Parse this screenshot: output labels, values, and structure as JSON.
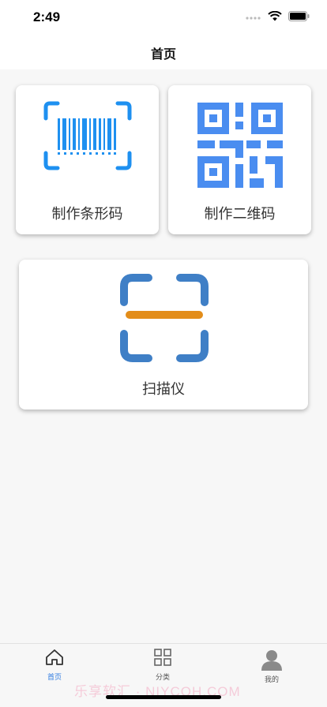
{
  "status": {
    "time": "2:49"
  },
  "nav": {
    "title": "首页"
  },
  "cards": {
    "barcode": {
      "label": "制作条形码",
      "icon": "barcode-icon"
    },
    "qrcode": {
      "label": "制作二维码",
      "icon": "qr-code-icon"
    },
    "scanner": {
      "label": "扫描仪",
      "icon": "scan-icon"
    }
  },
  "tabs": [
    {
      "label": "首页",
      "icon": "home-icon",
      "active": true
    },
    {
      "label": "分类",
      "icon": "grid-icon",
      "active": false
    },
    {
      "label": "我的",
      "icon": "person-icon",
      "active": false
    }
  ],
  "watermark": "乐享软汇 · NIYCOH.COM",
  "colors": {
    "accent": "#2f7be0",
    "barcode_blue": "#1e90f0",
    "qr_blue": "#4a8df0",
    "scan_frame": "#3f7fc6",
    "scan_line": "#e38d1a"
  }
}
